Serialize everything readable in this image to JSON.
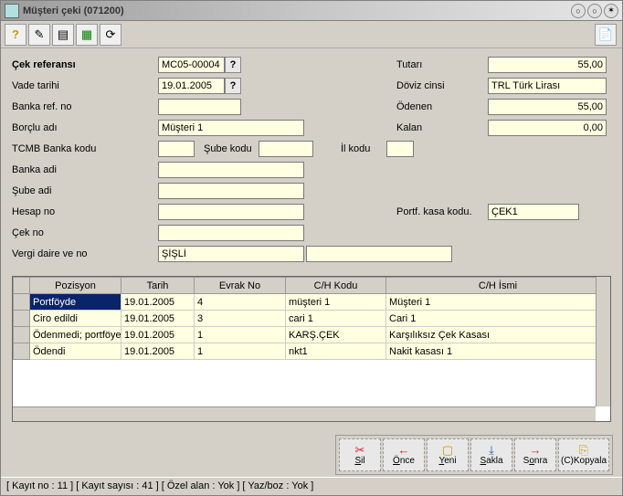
{
  "window": {
    "title": "Müşteri çeki (071200)"
  },
  "labels": {
    "cek_ref": "Çek referansı",
    "vade": "Vade tarihi",
    "banka_ref": "Banka ref. no",
    "borclu": "Borçlu adı",
    "tcmb": "TCMB Banka kodu",
    "banka_adi": "Banka adi",
    "sube_adi": "Şube adi",
    "hesap_no": "Hesap no",
    "cek_no": "Çek no",
    "vergi": "Vergi daire ve no",
    "sube_kodu": "Şube kodu",
    "il_kodu": "İl kodu",
    "tutari": "Tutarı",
    "doviz": "Döviz cinsi",
    "odenen": "Ödenen",
    "kalan": "Kalan",
    "portf_kasa": "Portf. kasa kodu."
  },
  "values": {
    "cek_ref": "MC05-00004",
    "vade": "19.01.2005",
    "banka_ref": "",
    "borclu": "Müşteri 1",
    "tcmb": "",
    "sube_kodu": "",
    "il_kodu": "",
    "banka_adi": "",
    "sube_adi": "",
    "hesap_no": "",
    "cek_no": "",
    "vergi_daire": "ŞİŞLİ",
    "vergi_no": "",
    "tutari": "55,00",
    "doviz": "TRL Türk Lirası",
    "odenen": "55,00",
    "kalan": "0,00",
    "portf_kasa": "ÇEK1"
  },
  "grid": {
    "headers": [
      "Pozisyon",
      "Tarih",
      "Evrak No",
      "C/H Kodu",
      "C/H İsmi"
    ],
    "rows": [
      {
        "pozisyon": "Portföyde",
        "tarih": "19.01.2005",
        "evrak": "4",
        "chkodu": "müşteri 1",
        "chismi": "Müşteri 1"
      },
      {
        "pozisyon": "Ciro edildi",
        "tarih": "19.01.2005",
        "evrak": "3",
        "chkodu": "cari 1",
        "chismi": "Cari 1"
      },
      {
        "pozisyon": "Ödenmedi; portföye iade",
        "tarih": "19.01.2005",
        "evrak": "1",
        "chkodu": "KARŞ.ÇEK",
        "chismi": "Karşılıksız Çek Kasası"
      },
      {
        "pozisyon": "Ödendi",
        "tarih": "19.01.2005",
        "evrak": "1",
        "chkodu": "nkt1",
        "chismi": "Nakit kasası 1"
      }
    ]
  },
  "actions": {
    "sil": "Sil",
    "once": "Önce",
    "yeni": "Yeni",
    "sakla": "Sakla",
    "sonra": "Sonra",
    "kopyala": "(C)Kopyala"
  },
  "status": "[ Kayıt no : 11 ] [ Kayıt sayısı : 41 ] [ Özel alan : Yok ] [ Yaz/boz : Yok ]"
}
